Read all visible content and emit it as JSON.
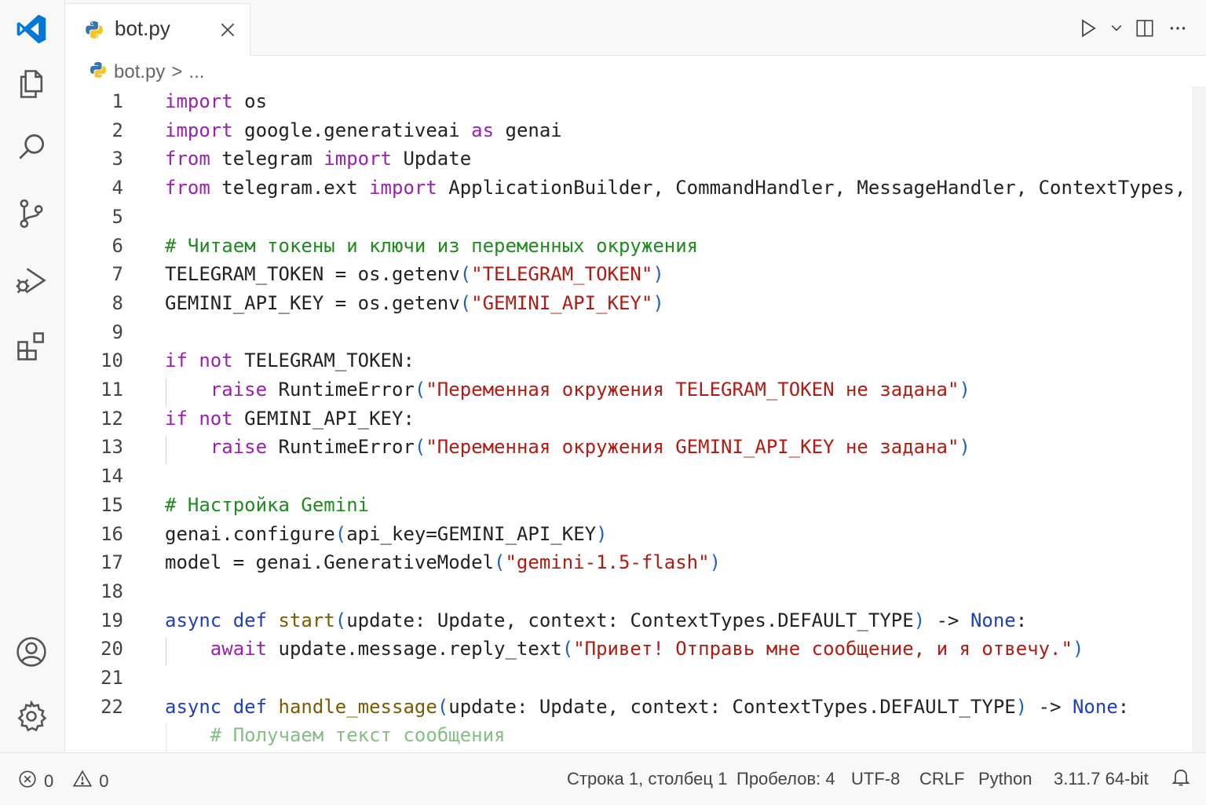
{
  "tab": {
    "filename": "bot.py"
  },
  "breadcrumb": {
    "file": "bot.py",
    "sep": ">",
    "more": "..."
  },
  "code_lines": [
    {
      "n": "1",
      "segs": [
        [
          "kw",
          "import"
        ],
        [
          "",
          " os"
        ]
      ]
    },
    {
      "n": "2",
      "segs": [
        [
          "kw",
          "import"
        ],
        [
          "",
          " google.generativeai "
        ],
        [
          "kw",
          "as"
        ],
        [
          "",
          " genai"
        ]
      ]
    },
    {
      "n": "3",
      "segs": [
        [
          "kw",
          "from"
        ],
        [
          "",
          " telegram "
        ],
        [
          "kw",
          "import"
        ],
        [
          "",
          " Update"
        ]
      ]
    },
    {
      "n": "4",
      "segs": [
        [
          "kw",
          "from"
        ],
        [
          "",
          " telegram.ext "
        ],
        [
          "kw",
          "import"
        ],
        [
          "",
          " ApplicationBuilder, CommandHandler, MessageHandler, ContextTypes, filters"
        ]
      ]
    },
    {
      "n": "5",
      "segs": []
    },
    {
      "n": "6",
      "segs": [
        [
          "cm",
          "# Читаем токены и ключи из переменных окружения"
        ]
      ]
    },
    {
      "n": "7",
      "segs": [
        [
          "",
          "TELEGRAM_TOKEN = os.getenv"
        ],
        [
          "pa",
          "("
        ],
        [
          "st",
          "\"TELEGRAM_TOKEN\""
        ],
        [
          "pa",
          ")"
        ]
      ]
    },
    {
      "n": "8",
      "segs": [
        [
          "",
          "GEMINI_API_KEY = os.getenv"
        ],
        [
          "pa",
          "("
        ],
        [
          "st",
          "\"GEMINI_API_KEY\""
        ],
        [
          "pa",
          ")"
        ]
      ]
    },
    {
      "n": "9",
      "segs": []
    },
    {
      "n": "10",
      "segs": [
        [
          "kw",
          "if"
        ],
        [
          "",
          " "
        ],
        [
          "kw",
          "not"
        ],
        [
          "",
          " TELEGRAM_TOKEN:"
        ]
      ]
    },
    {
      "n": "11",
      "guide": true,
      "segs": [
        [
          "",
          "    "
        ],
        [
          "kw",
          "raise"
        ],
        [
          "",
          " RuntimeError"
        ],
        [
          "pa",
          "("
        ],
        [
          "st",
          "\"Переменная окружения TELEGRAM_TOKEN не задана\""
        ],
        [
          "pa",
          ")"
        ]
      ]
    },
    {
      "n": "12",
      "segs": [
        [
          "kw",
          "if"
        ],
        [
          "",
          " "
        ],
        [
          "kw",
          "not"
        ],
        [
          "",
          " GEMINI_API_KEY:"
        ]
      ]
    },
    {
      "n": "13",
      "guide": true,
      "segs": [
        [
          "",
          "    "
        ],
        [
          "kw",
          "raise"
        ],
        [
          "",
          " RuntimeError"
        ],
        [
          "pa",
          "("
        ],
        [
          "st",
          "\"Переменная окружения GEMINI_API_KEY не задана\""
        ],
        [
          "pa",
          ")"
        ]
      ]
    },
    {
      "n": "14",
      "segs": []
    },
    {
      "n": "15",
      "segs": [
        [
          "cm",
          "# Настройка Gemini"
        ]
      ]
    },
    {
      "n": "16",
      "segs": [
        [
          "",
          "genai.configure"
        ],
        [
          "pa",
          "("
        ],
        [
          "",
          "api_key=GEMINI_API_KEY"
        ],
        [
          "pa",
          ")"
        ]
      ]
    },
    {
      "n": "17",
      "segs": [
        [
          "",
          "model = genai.GenerativeModel"
        ],
        [
          "pa",
          "("
        ],
        [
          "st",
          "\"gemini-1.5-flash\""
        ],
        [
          "pa",
          ")"
        ]
      ]
    },
    {
      "n": "18",
      "segs": []
    },
    {
      "n": "19",
      "segs": [
        [
          "kw2",
          "async"
        ],
        [
          "",
          " "
        ],
        [
          "kw2",
          "def"
        ],
        [
          "",
          " "
        ],
        [
          "fn",
          "start"
        ],
        [
          "pa",
          "("
        ],
        [
          "",
          "update: Update, context: ContextTypes.DEFAULT_TYPE"
        ],
        [
          "pa",
          ")"
        ],
        [
          "",
          " -> "
        ],
        [
          "kw2",
          "None"
        ],
        [
          "",
          ":"
        ]
      ]
    },
    {
      "n": "20",
      "guide": true,
      "segs": [
        [
          "",
          "    "
        ],
        [
          "kw",
          "await"
        ],
        [
          "",
          " update.message.reply_text"
        ],
        [
          "pa",
          "("
        ],
        [
          "st",
          "\"Привет! Отправь мне сообщение, и я отвечу.\""
        ],
        [
          "pa",
          ")"
        ]
      ]
    },
    {
      "n": "21",
      "segs": []
    },
    {
      "n": "22",
      "segs": [
        [
          "kw2",
          "async"
        ],
        [
          "",
          " "
        ],
        [
          "kw2",
          "def"
        ],
        [
          "",
          " "
        ],
        [
          "fn",
          "handle_message"
        ],
        [
          "pa",
          "("
        ],
        [
          "",
          "update: Update, context: ContextTypes.DEFAULT_TYPE"
        ],
        [
          "pa",
          ")"
        ],
        [
          "",
          " -> "
        ],
        [
          "kw2",
          "None"
        ],
        [
          "",
          ":"
        ]
      ]
    },
    {
      "n": "",
      "guide": true,
      "fade": true,
      "segs": [
        [
          "",
          "    "
        ],
        [
          "cm",
          "# Получаем текст сообщения"
        ]
      ]
    }
  ],
  "status": {
    "errors": "0",
    "warnings": "0",
    "cursor": "Строка 1, столбец 1",
    "spaces": "Пробелов: 4",
    "encoding": "UTF-8",
    "eol": "CRLF",
    "language": "Python",
    "interpreter": "3.11.7 64-bit"
  },
  "colors": {
    "accent": "#0078d4",
    "keyword": "#9b1fb0",
    "comment": "#1f8a1f",
    "string": "#b01c14"
  }
}
